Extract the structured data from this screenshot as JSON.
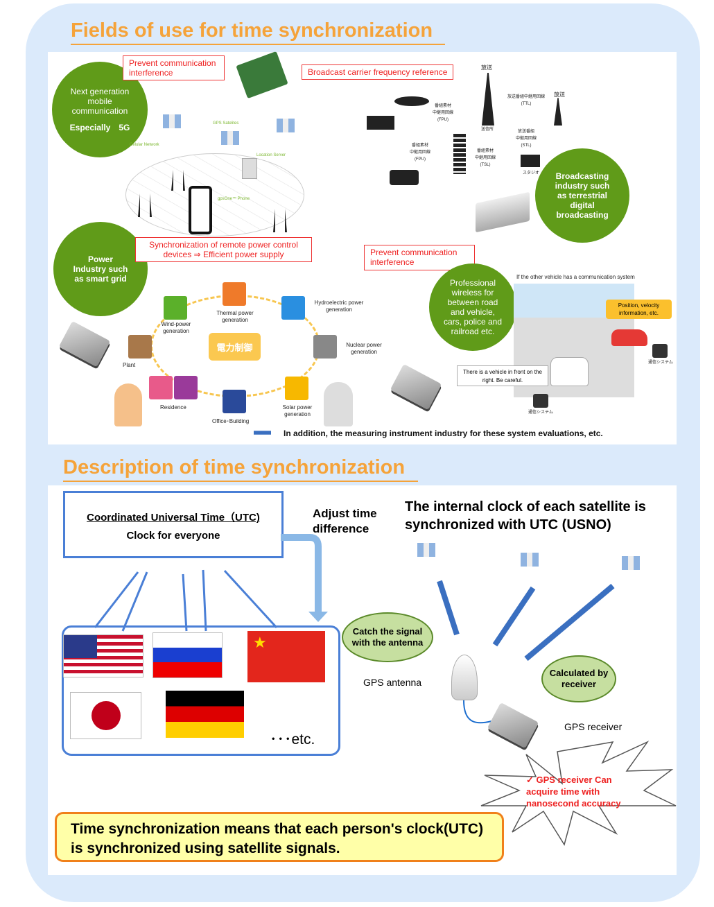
{
  "section1": {
    "title": "Fields of use for time synchronization",
    "circles": {
      "5g": [
        "Next generation",
        "mobile",
        "communication"
      ],
      "5g_bold": "Especially　5G",
      "broadcast": [
        "Broadcasting",
        "industry such",
        "as terrestrial",
        "digital",
        "broadcasting"
      ],
      "power": [
        "Power",
        "Industry such",
        "as smart grid"
      ],
      "wireless": [
        "Professional",
        "wireless for",
        "between road",
        "and vehicle,",
        "cars, police and",
        "railroad etc."
      ]
    },
    "boxes": {
      "prevent1": "Prevent communication interference",
      "broadcast_ref": "Broadcast carrier frequency reference",
      "power_sync": "Synchronization of remote power control devices ⇒ Efficient power supply",
      "prevent2": "Prevent communication interference"
    },
    "network": {
      "gps_satellites": "GPS Satelites",
      "cellular": "Celular Network",
      "location_server": "Location Server",
      "phone": "gpsOne™ Phone"
    },
    "broadcast_labels": {
      "hoso1": "放送",
      "hoso2": "放送",
      "ttl": "放送番組中継用回線\n(TTL)",
      "fpu1": "番組素材\n中継用回線\n(FPU)",
      "fpu2": "番組素材\n中継用回線\n(FPU)",
      "tsl": "番組素材\n中継用回線\n(TSL)",
      "stl": "放送番組\n中継用回線\n(STL)",
      "transmitter": "送信所",
      "studio": "スタジオ"
    },
    "grid": {
      "center": "電力制御",
      "thermal": "Thermal power generation",
      "hydro": "Hydroelectric power generation",
      "wind": "Wind-power generation",
      "plant": "Plant",
      "nuclear": "Nuclear power generation",
      "residence": "Residence",
      "office": "Office･Building",
      "solar": "Solar power generation"
    },
    "vehicle": {
      "header": "If the other vehicle has a communication system",
      "position": "Position, velocity information, etc.",
      "warning": "There is a vehicle in front on the right. Be careful.",
      "comm1": "通信システム",
      "comm2": "通信システム"
    },
    "footer": "In addition, the measuring instrument industry for these system evaluations, etc."
  },
  "section2": {
    "title": "Description of time synchronization",
    "utc_title": "Coordinated Universal Time（UTC)",
    "utc_sub": "Clock for everyone",
    "adjust": "Adjust time difference",
    "satellite_text": "The internal clock of each satellite is synchronized with UTC (USNO)",
    "catch": "Catch the signal with the antenna",
    "antenna": "GPS antenna",
    "calculated": "Calculated by receiver",
    "receiver": "GPS receiver",
    "etc": "･･･etc.",
    "burst": "✓ GPS receiver Can acquire time with nanosecond accuracy",
    "summary": "Time synchronization means that each person's clock(UTC) is synchronized using satellite signals."
  },
  "colors": {
    "accent": "#f5a33a",
    "green": "#609b19",
    "blue": "#4a7fd6",
    "red": "#e22222"
  }
}
